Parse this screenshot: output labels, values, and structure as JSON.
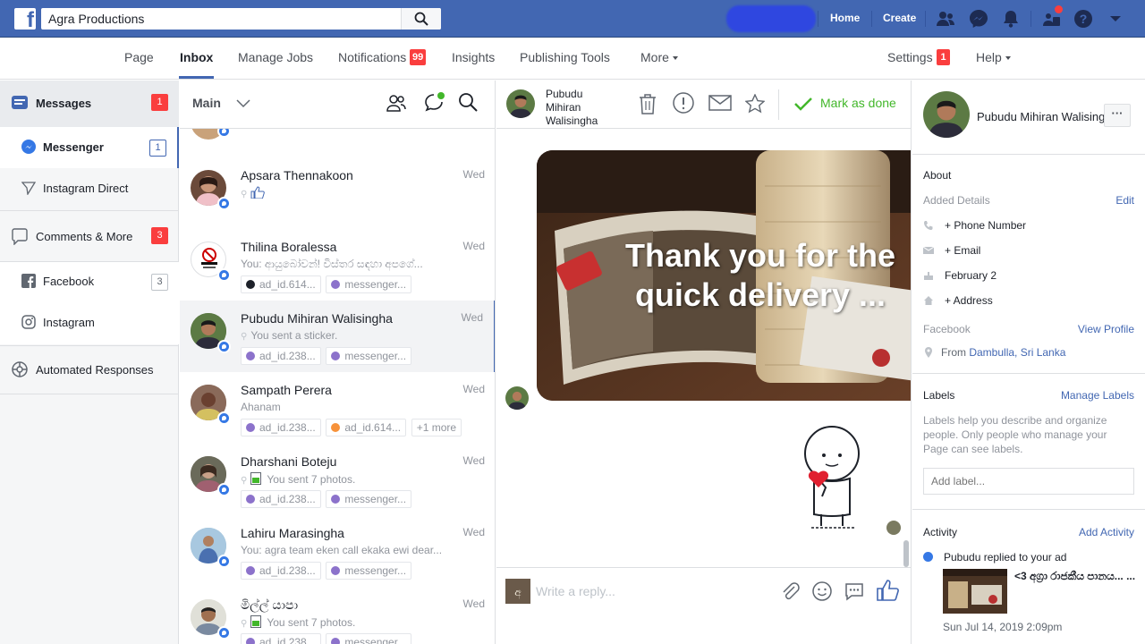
{
  "topbar": {
    "search_value": "Agra Productions",
    "links": [
      "Home",
      "Create"
    ],
    "icons": [
      "find-friends-icon",
      "messenger-icon",
      "notifications-icon",
      "page-switch-icon",
      "help-icon",
      "account-menu-icon"
    ]
  },
  "pagenav": {
    "items": [
      "Page",
      "Inbox",
      "Manage Jobs",
      "Notifications",
      "Insights",
      "Publishing Tools",
      "More"
    ],
    "notifications_badge": "99",
    "settings": "Settings",
    "settings_badge": "1",
    "help": "Help",
    "active": "Inbox"
  },
  "sidebar": {
    "messages": {
      "label": "Messages",
      "count": "1"
    },
    "messenger": {
      "label": "Messenger",
      "count": "1"
    },
    "instagram_direct": {
      "label": "Instagram Direct"
    },
    "comments": {
      "label": "Comments & More",
      "count": "3"
    },
    "facebook": {
      "label": "Facebook",
      "count": "3"
    },
    "instagram": {
      "label": "Instagram"
    },
    "automated": {
      "label": "Automated Responses"
    }
  },
  "conversations": {
    "filter_label": "Main",
    "items": [
      {
        "name": "Apsara Thennakoon",
        "time": "Wed",
        "snippet": ""
      },
      {
        "name": "Thilina Boralessa",
        "time": "Wed",
        "snippet": "You: ආයුබෝවන්! විස්තර සඳහා අපගේ...",
        "tags": [
          "ad_id.614...",
          "messenger..."
        ]
      },
      {
        "name": "Pubudu Mihiran Walisingha",
        "time": "Wed",
        "snippet": "You sent a sticker.",
        "tags": [
          "ad_id.238...",
          "messenger..."
        ]
      },
      {
        "name": "Sampath Perera",
        "time": "Wed",
        "snippet": "Ahanam",
        "tags": [
          "ad_id.238...",
          "ad_id.614...",
          "+1 more"
        ]
      },
      {
        "name": "Dharshani Boteju",
        "time": "Wed",
        "snippet": "You sent 7 photos.",
        "tags": [
          "ad_id.238...",
          "messenger..."
        ]
      },
      {
        "name": "Lahiru Marasingha",
        "time": "Wed",
        "snippet": "You: agra team eken call ekaka ewi dear...",
        "tags": [
          "ad_id.238...",
          "messenger..."
        ]
      },
      {
        "name": "මිල්ල් යාපා",
        "time": "Wed",
        "snippet": "You sent 7 photos.",
        "tags": [
          "ad_id.238...",
          "messenger..."
        ]
      }
    ]
  },
  "chat": {
    "contact_name": "Pubudu Mihiran Walisingha",
    "mark_done": "Mark as done",
    "photo_text": "Thank you for the quick delivery ...",
    "reply_placeholder": "Write a reply..."
  },
  "info": {
    "name": "Pubudu Mihiran Walisingha",
    "about": "About",
    "added_details": "Added Details",
    "edit": "Edit",
    "phone": "+ Phone Number",
    "email": "+ Email",
    "birthday": "February 2",
    "address": "+ Address",
    "facebook": "Facebook",
    "view_profile": "View Profile",
    "location": "Dambulla, Sri Lanka",
    "location_prefix": "From",
    "labels": "Labels",
    "manage_labels": "Manage Labels",
    "labels_help": "Labels help you describe and organize people. Only people who manage your Page can see labels.",
    "add_label_placeholder": "Add label...",
    "activity": "Activity",
    "add_activity": "Add Activity",
    "activity_text": "Pubudu replied to your ad",
    "ad_title": "<3 අග්‍රා රාජකීය පානය... ...",
    "activity_time": "Sun Jul 14, 2019 2:09pm"
  },
  "colors": {
    "brand": "#4267b2",
    "badge": "#fa3e3e",
    "done": "#42b72a",
    "link": "#4267b2"
  }
}
